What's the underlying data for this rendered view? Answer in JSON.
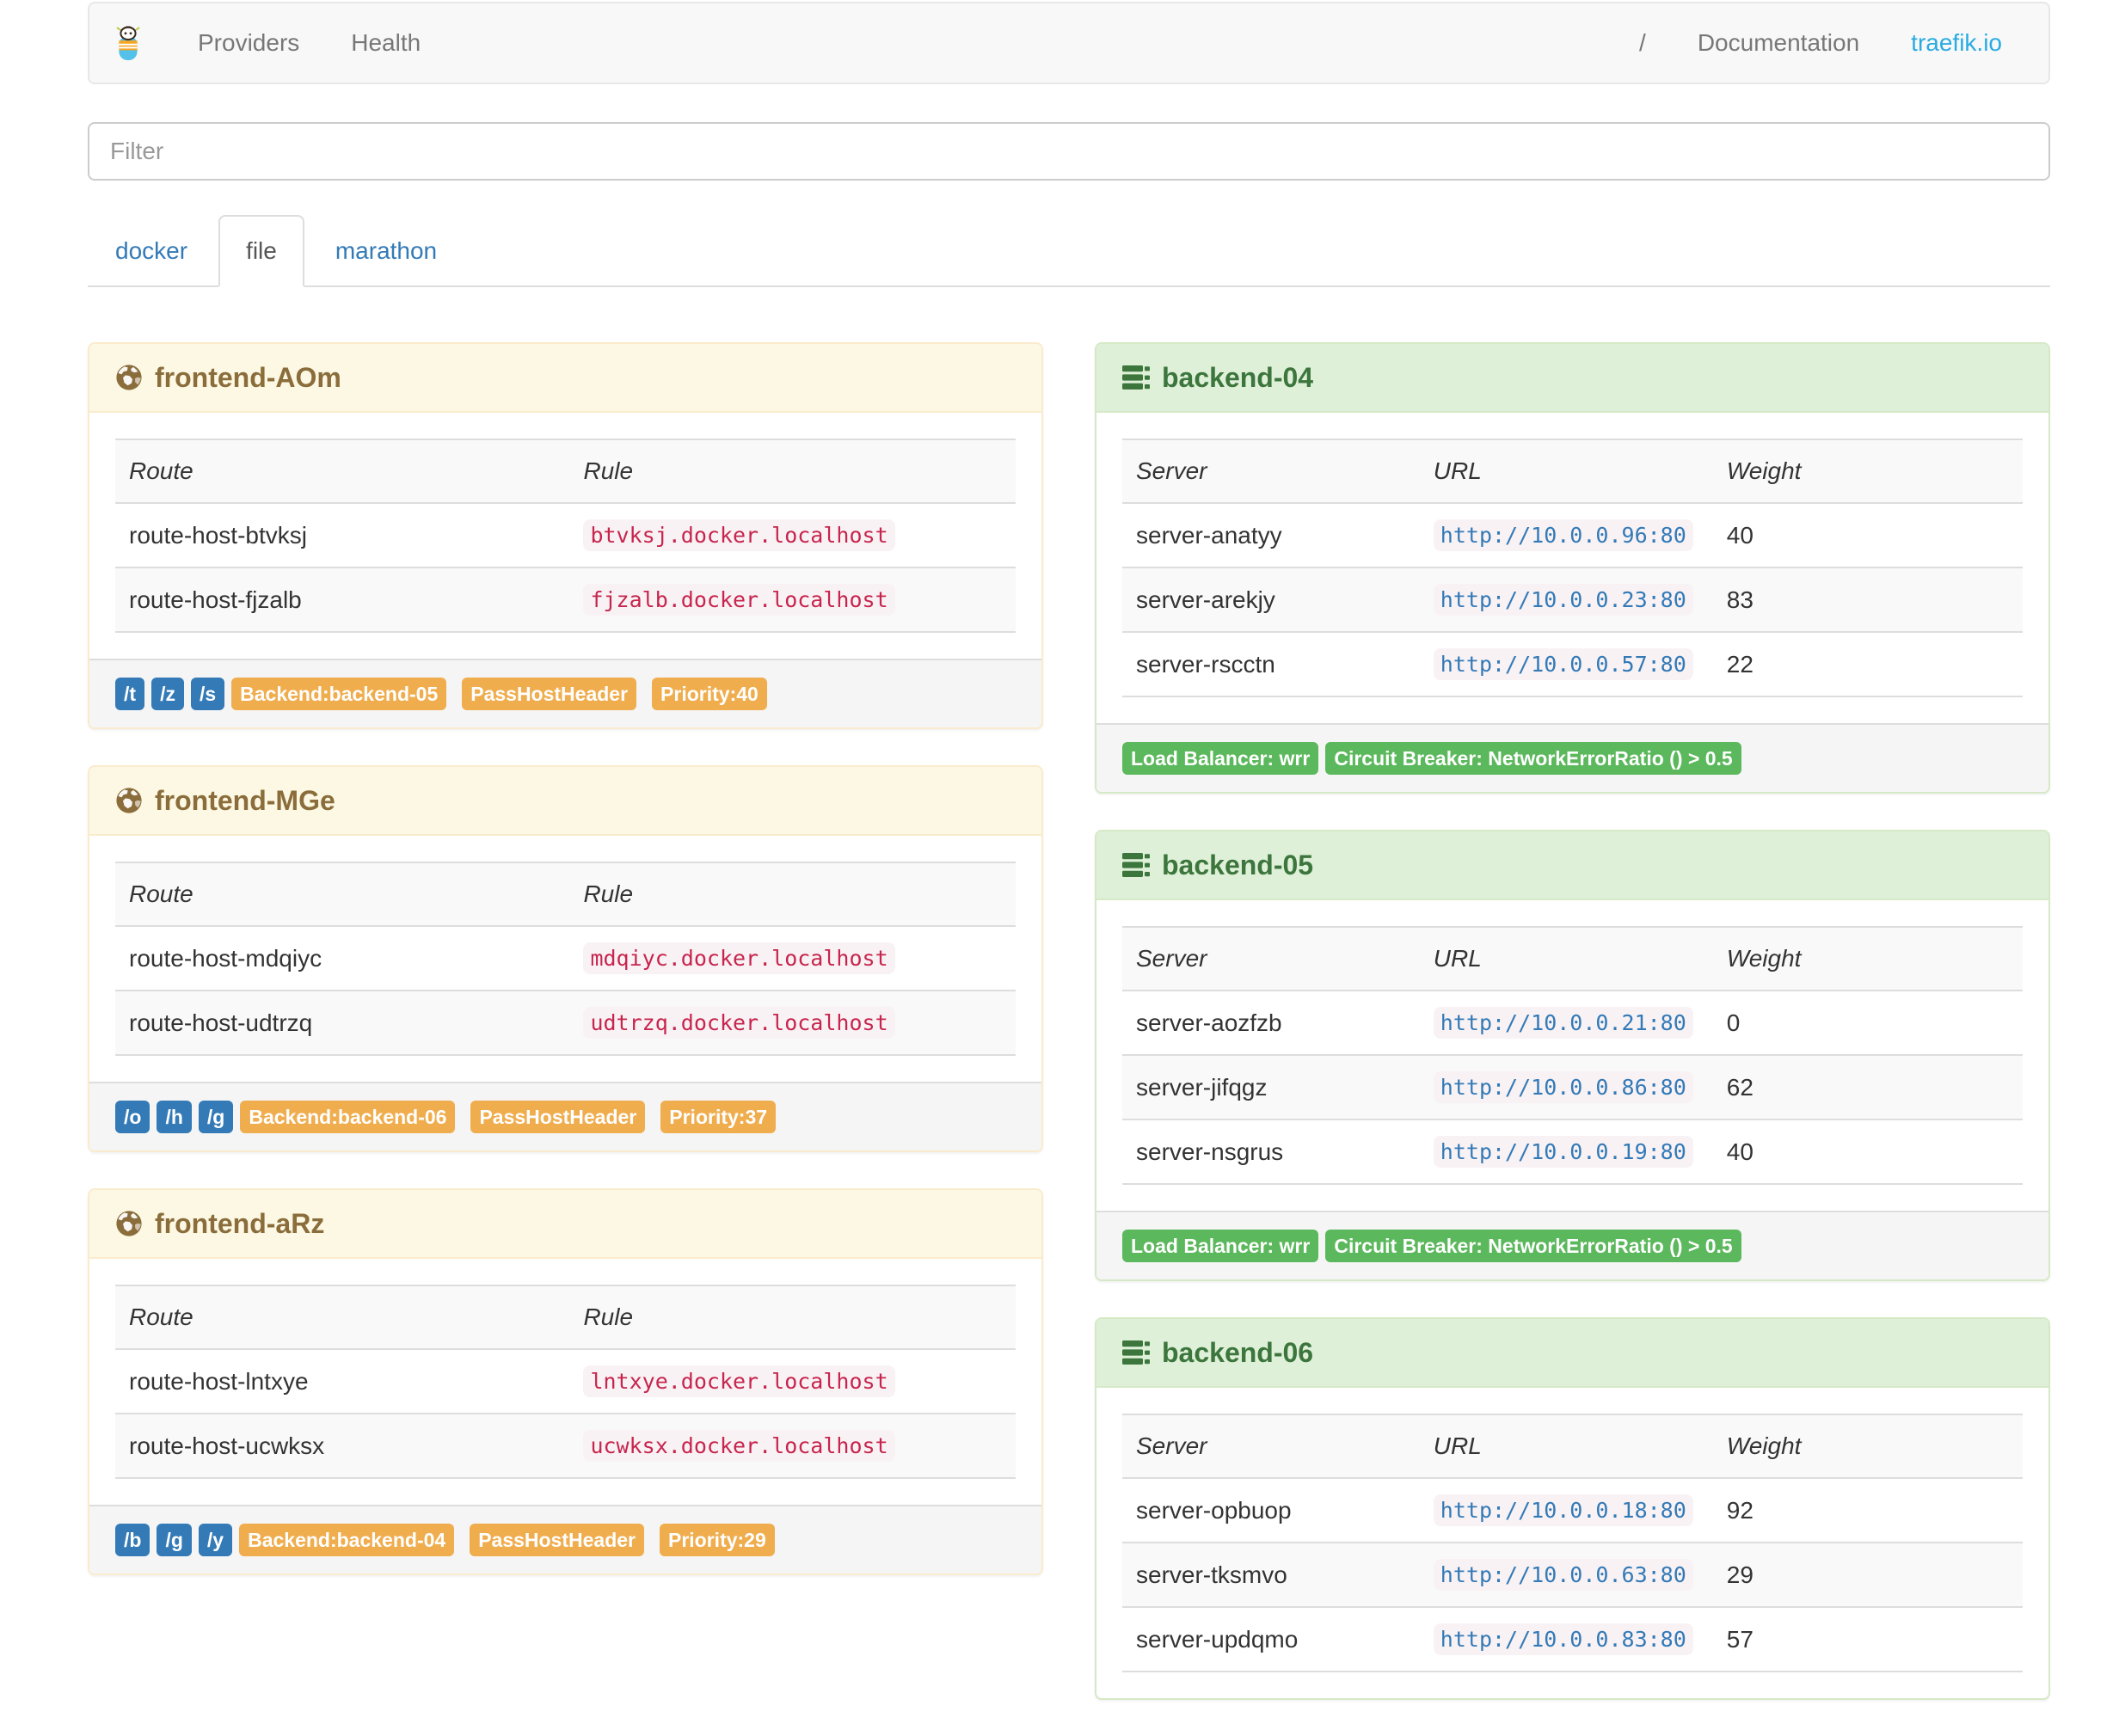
{
  "navbar": {
    "brand_icon": "traefik-logo",
    "links_left": [
      "Providers",
      "Health"
    ],
    "links_right": [
      "/",
      "Documentation",
      "traefik.io"
    ],
    "brand_link_color": "#29abe2"
  },
  "filter": {
    "placeholder": "Filter"
  },
  "tabs": [
    {
      "label": "docker",
      "active": false
    },
    {
      "label": "file",
      "active": true
    },
    {
      "label": "marathon",
      "active": false
    }
  ],
  "table_headers": {
    "frontend": [
      "Route",
      "Rule"
    ],
    "backend": [
      "Server",
      "URL",
      "Weight"
    ]
  },
  "frontends": [
    {
      "name": "frontend-AOm",
      "icon": "globe-icon",
      "routes": [
        {
          "route": "route-host-btvksj",
          "rule": "btvksj.docker.localhost"
        },
        {
          "route": "route-host-fjzalb",
          "rule": "fjzalb.docker.localhost"
        }
      ],
      "route_badges": [
        "/t",
        "/z",
        "/s"
      ],
      "prop_badges": [
        "Backend:backend-05",
        "PassHostHeader",
        "Priority:40"
      ]
    },
    {
      "name": "frontend-MGe",
      "icon": "globe-icon",
      "routes": [
        {
          "route": "route-host-mdqiyc",
          "rule": "mdqiyc.docker.localhost"
        },
        {
          "route": "route-host-udtrzq",
          "rule": "udtrzq.docker.localhost"
        }
      ],
      "route_badges": [
        "/o",
        "/h",
        "/g"
      ],
      "prop_badges": [
        "Backend:backend-06",
        "PassHostHeader",
        "Priority:37"
      ]
    },
    {
      "name": "frontend-aRz",
      "icon": "globe-icon",
      "routes": [
        {
          "route": "route-host-lntxye",
          "rule": "lntxye.docker.localhost"
        },
        {
          "route": "route-host-ucwksx",
          "rule": "ucwksx.docker.localhost"
        }
      ],
      "route_badges": [
        "/b",
        "/g",
        "/y"
      ],
      "prop_badges": [
        "Backend:backend-04",
        "PassHostHeader",
        "Priority:29"
      ]
    }
  ],
  "backends": [
    {
      "name": "backend-04",
      "icon": "server-icon",
      "servers": [
        {
          "server": "server-anatyy",
          "url": "http://10.0.0.96:80",
          "weight": "40"
        },
        {
          "server": "server-arekjy",
          "url": "http://10.0.0.23:80",
          "weight": "83"
        },
        {
          "server": "server-rscctn",
          "url": "http://10.0.0.57:80",
          "weight": "22"
        }
      ],
      "badges": [
        "Load Balancer: wrr",
        "Circuit Breaker: NetworkErrorRatio () > 0.5"
      ]
    },
    {
      "name": "backend-05",
      "icon": "server-icon",
      "servers": [
        {
          "server": "server-aozfzb",
          "url": "http://10.0.0.21:80",
          "weight": "0"
        },
        {
          "server": "server-jifqgz",
          "url": "http://10.0.0.86:80",
          "weight": "62"
        },
        {
          "server": "server-nsgrus",
          "url": "http://10.0.0.19:80",
          "weight": "40"
        }
      ],
      "badges": [
        "Load Balancer: wrr",
        "Circuit Breaker: NetworkErrorRatio () > 0.5"
      ]
    },
    {
      "name": "backend-06",
      "icon": "server-icon",
      "servers": [
        {
          "server": "server-opbuop",
          "url": "http://10.0.0.18:80",
          "weight": "92"
        },
        {
          "server": "server-tksmvo",
          "url": "http://10.0.0.63:80",
          "weight": "29"
        },
        {
          "server": "server-updqmo",
          "url": "http://10.0.0.83:80",
          "weight": "57"
        }
      ],
      "badges": []
    }
  ]
}
